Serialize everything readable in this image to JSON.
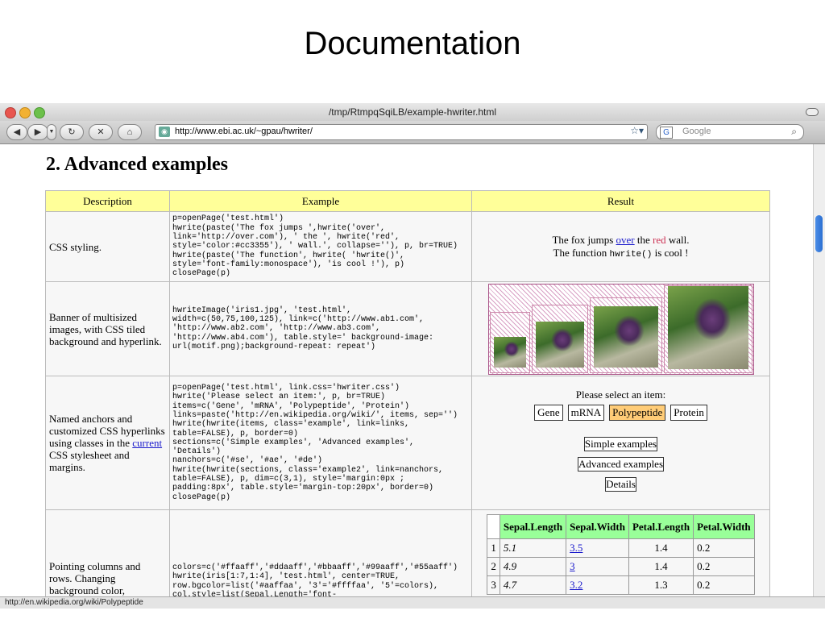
{
  "slide": {
    "title": "Documentation"
  },
  "browser": {
    "window_title": "/tmp/RtmpqSqiLB/example-hwriter.html",
    "url": "http://www.ebi.ac.uk/~gpau/hwriter/",
    "search_placeholder": "Google",
    "status_text": "http://en.wikipedia.org/wiki/Polypeptide"
  },
  "page": {
    "heading": "2. Advanced examples",
    "columns": [
      "Description",
      "Example",
      "Result"
    ],
    "rows": [
      {
        "desc": "CSS styling.",
        "code": "p=openPage('test.html')\nhwrite(paste('The fox jumps ',hwrite('over',\nlink='http://over.com'), ' the ', hwrite('red',\nstyle='color:#cc3355'), ' wall.', collapse=''), p, br=TRUE)\nhwrite(paste('The function', hwrite( 'hwrite()',\nstyle='font-family:monospace'), 'is cool !'), p)\nclosePage(p)",
        "res1_a": "The fox jumps ",
        "res1_link": "over",
        "res1_b": " the ",
        "res1_red": "red",
        "res1_c": " wall.",
        "res2_a": "The function ",
        "res2_mono": "hwrite()",
        "res2_b": " is cool !"
      },
      {
        "desc": "Banner of multisized images, with CSS tiled background and hyperlink.",
        "code": "hwriteImage('iris1.jpg', 'test.html',\nwidth=c(50,75,100,125), link=c('http://www.ab1.com',\n'http://www.ab2.com', 'http://www.ab3.com',\n'http://www.ab4.com'), table.style=' background-image:\nurl(motif.png);background-repeat: repeat')",
        "image_widths": [
          50,
          75,
          100,
          125
        ]
      },
      {
        "desc_a": "Named anchors and customized CSS hyperlinks using classes in the ",
        "desc_link": "current",
        "desc_b": " CSS stylesheet and margins.",
        "code": "p=openPage('test.html', link.css='hwriter.css')\nhwrite('Please select an item:', p, br=TRUE)\nitems=c('Gene', 'mRNA', 'Polypeptide', 'Protein')\nlinks=paste('http://en.wikipedia.org/wiki/', items, sep='')\nhwrite(hwrite(items, class='example', link=links,\ntable=FALSE), p, border=0)\nsections=c('Simple examples', 'Advanced examples',\n'Details')\nnanchors=c('#se', '#ae', '#de')\nhwrite(hwrite(sections, class='example2', link=nanchors,\ntable=FALSE), p, dim=c(3,1), style='margin:0px ;\npadding:8px', table.style='margin-top:20px', border=0)\nclosePage(p)",
        "prompt": "Please select an item:",
        "items": [
          "Gene",
          "mRNA",
          "Polypeptide",
          "Protein"
        ],
        "sections": [
          "Simple examples",
          "Advanced examples",
          "Details"
        ]
      },
      {
        "desc": "Pointing columns and rows. Changing background color,",
        "code": "colors=c('#ffaaff','#ddaaff','#bbaaff','#99aaff','#55aaff')\nhwrite(iris[1:7,1:4], 'test.html', center=TRUE,\nrow.bgcolor=list('#aaffaa', '3'='#ffffaa', '5'=colors),\ncol.style=list(Sepal.Length='font-",
        "table_headers": [
          "Sepal.Length",
          "Sepal.Width",
          "Petal.Length",
          "Petal.Width"
        ],
        "table_rows": [
          {
            "idx": "1",
            "sl": "5.1",
            "sw": "3.5",
            "pl": "1.4",
            "pw": "0.2"
          },
          {
            "idx": "2",
            "sl": "4.9",
            "sw": "3",
            "pl": "1.4",
            "pw": "0.2"
          },
          {
            "idx": "3",
            "sl": "4.7",
            "sw": "3.2",
            "pl": "1.3",
            "pw": "0.2"
          }
        ]
      }
    ]
  },
  "colors": {
    "red_text": "#cc3355",
    "header_bg": "#ffff99",
    "selected_item": "#ffcc77",
    "table_header": "#99ff99",
    "row3_bg": "#ffffaa"
  }
}
